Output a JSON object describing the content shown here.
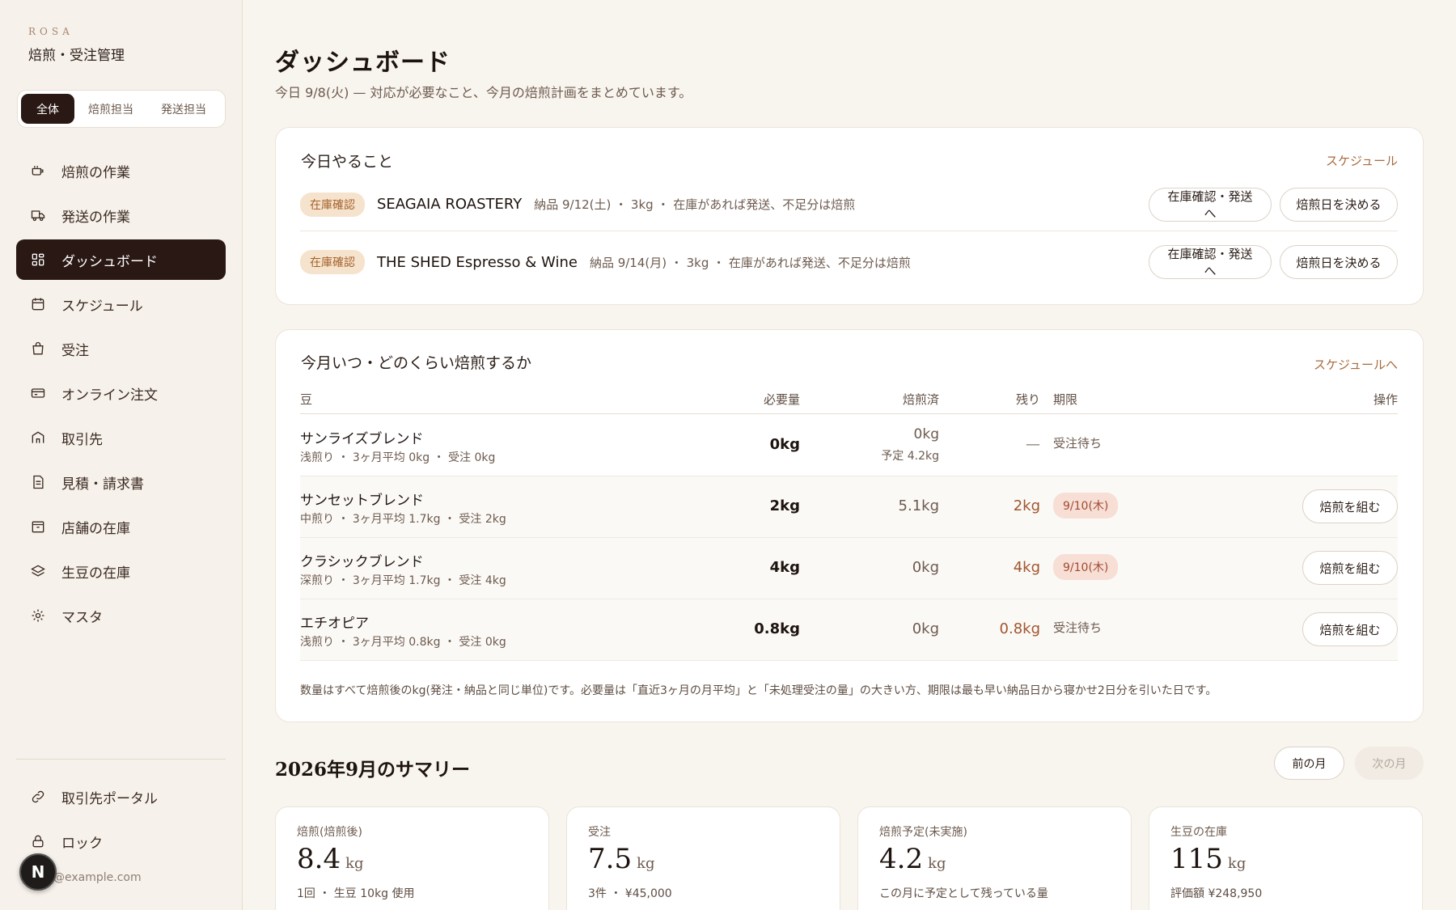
{
  "brand": {
    "name": "ROSA",
    "subtitle": "焙煎・受注管理"
  },
  "role_tabs": [
    "全体",
    "焙煎担当",
    "発送担当"
  ],
  "nav": [
    {
      "label": "焙煎の作業",
      "icon": "roaster-icon"
    },
    {
      "label": "発送の作業",
      "icon": "truck-icon"
    },
    {
      "label": "ダッシュボード",
      "icon": "dashboard-icon",
      "active": true
    },
    {
      "label": "スケジュール",
      "icon": "calendar-icon"
    },
    {
      "label": "受注",
      "icon": "bag-icon"
    },
    {
      "label": "オンライン注文",
      "icon": "card-icon"
    },
    {
      "label": "取引先",
      "icon": "store-icon"
    },
    {
      "label": "見積・請求書",
      "icon": "document-icon"
    },
    {
      "label": "店舗の在庫",
      "icon": "box-icon"
    },
    {
      "label": "生豆の在庫",
      "icon": "layers-icon"
    },
    {
      "label": "マスタ",
      "icon": "gear-icon"
    }
  ],
  "nav_bottom": [
    {
      "label": "取引先ポータル",
      "icon": "link-icon"
    },
    {
      "label": "ロック",
      "icon": "lock-icon"
    }
  ],
  "user": {
    "email": "@example.com",
    "avatar": "N"
  },
  "page": {
    "title": "ダッシュボード",
    "subtitle": "今日 9/8(火) — 対応が必要なこと、今月の焙煎計画をまとめています。"
  },
  "today": {
    "title": "今日やること",
    "link": "スケジュール",
    "tasks": [
      {
        "badge": "在庫確認",
        "name": "SEAGAIA ROASTERY",
        "meta": "納品 9/12(土) ・ 3kg ・ 在庫があれば発送、不足分は焙煎",
        "btn1": "在庫確認・発送へ",
        "btn2": "焙煎日を決める"
      },
      {
        "badge": "在庫確認",
        "name": "THE SHED Espresso & Wine",
        "meta": "納品 9/14(月) ・ 3kg ・ 在庫があれば発送、不足分は焙煎",
        "btn1": "在庫確認・発送へ",
        "btn2": "焙煎日を決める"
      }
    ]
  },
  "plan": {
    "title": "今月いつ・どのくらい焙煎するか",
    "link": "スケジュールへ",
    "headers": {
      "bean": "豆",
      "required": "必要量",
      "roasted": "焙煎済",
      "remaining": "残り",
      "due": "期限",
      "action": "操作"
    },
    "rows": [
      {
        "name": "サンライズブレンド",
        "meta": "浅煎り ・ 3ヶ月平均 0kg ・ 受注 0kg",
        "required": "0kg",
        "roasted": "0kg",
        "planned": "予定 4.2kg",
        "remaining": "—",
        "due": "受注待ち"
      },
      {
        "name": "サンセットブレンド",
        "meta": "中煎り ・ 3ヶ月平均 1.7kg ・ 受注 2kg",
        "required": "2kg",
        "roasted": "5.1kg",
        "remaining": "2kg",
        "due": "9/10(木)",
        "action": "焙煎を組む"
      },
      {
        "name": "クラシックブレンド",
        "meta": "深煎り ・ 3ヶ月平均 1.7kg ・ 受注 4kg",
        "required": "4kg",
        "roasted": "0kg",
        "remaining": "4kg",
        "due": "9/10(木)",
        "action": "焙煎を組む"
      },
      {
        "name": "エチオピア",
        "meta": "浅煎り ・ 3ヶ月平均 0.8kg ・ 受注 0kg",
        "required": "0.8kg",
        "roasted": "0kg",
        "remaining": "0.8kg",
        "due": "受注待ち",
        "action": "焙煎を組む"
      }
    ],
    "note": "数量はすべて焙煎後のkg(発注・納品と同じ単位)です。必要量は「直近3ヶ月の月平均」と「未処理受注の量」の大きい方、期限は最も早い納品日から寝かせ2日分を引いた日です。"
  },
  "summary": {
    "title": "2026年9月のサマリー",
    "prev": "前の月",
    "next": "次の月",
    "stats": [
      {
        "label": "焙煎(焙煎後)",
        "value": "8.4",
        "unit": "kg",
        "note": "1回 ・ 生豆 10kg 使用"
      },
      {
        "label": "受注",
        "value": "7.5",
        "unit": "kg",
        "note": "3件 ・ ¥45,000"
      },
      {
        "label": "焙煎予定(未実施)",
        "value": "4.2",
        "unit": "kg",
        "note": "この月に予定として残っている量"
      },
      {
        "label": "生豆の在庫",
        "value": "115",
        "unit": "kg",
        "note": "評価額 ¥248,950"
      }
    ]
  },
  "colors": {
    "accent": "#2a1814",
    "link": "#a86a3c",
    "badge_bg": "#f6e3cd",
    "due_bg": "#f7dfd6"
  }
}
